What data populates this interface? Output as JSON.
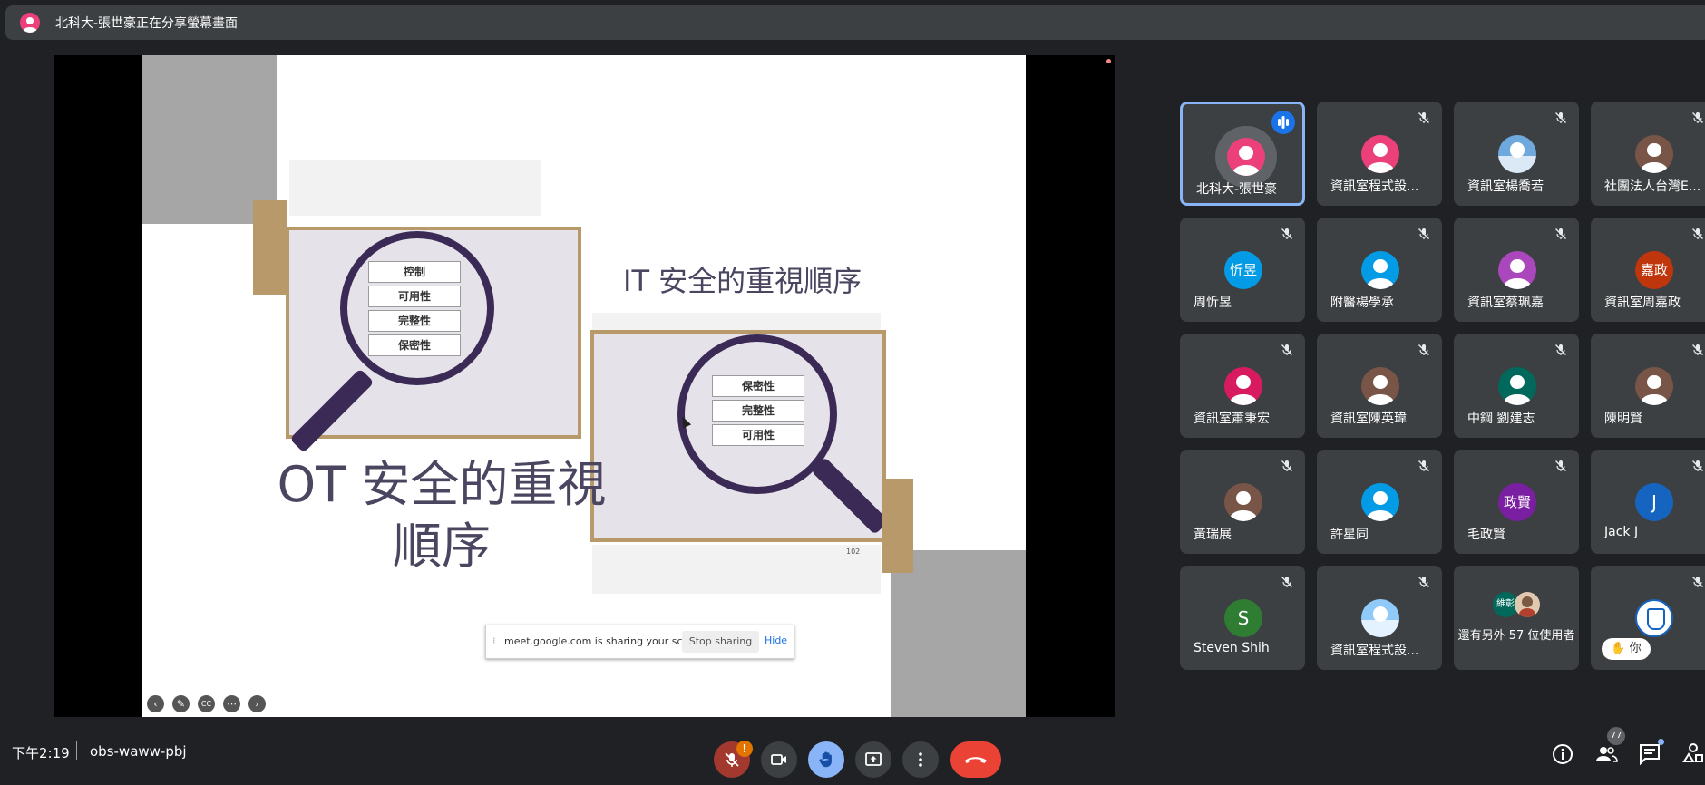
{
  "header": {
    "presenter_text": "北科大-張世豪正在分享螢幕畫面"
  },
  "slide": {
    "it_title": "IT 安全的重視順序",
    "ot_title": "OT 安全的重視順序",
    "ot_labels": [
      "控制",
      "可用性",
      "完整性",
      "保密性"
    ],
    "it_labels": [
      "保密性",
      "完整性",
      "可用性"
    ],
    "page_number": "102",
    "controls": [
      "prev",
      "pen",
      "cc",
      "more",
      "next"
    ]
  },
  "share_bar": {
    "message": "meet.google.com is sharing your screen.",
    "stop_label": "Stop sharing",
    "hide_label": "Hide"
  },
  "participants": [
    {
      "name": "北科大-張世豪",
      "avatar": "person",
      "color": "#ec407a",
      "speaking": true
    },
    {
      "name": "資訊室程式設...",
      "avatar": "person",
      "color": "#ec407a"
    },
    {
      "name": "資訊室楊喬若",
      "avatar": "photo",
      "color": "#6fa8dc"
    },
    {
      "name": "社團法人台灣E...",
      "avatar": "person",
      "color": "#795548"
    },
    {
      "name": "周忻昱",
      "avatar": "忻昱",
      "color": "#039be5"
    },
    {
      "name": "附醫楊學承",
      "avatar": "person",
      "color": "#039be5"
    },
    {
      "name": "資訊室蔡珮嘉",
      "avatar": "person",
      "color": "#ab47bc"
    },
    {
      "name": "資訊室周嘉政",
      "avatar": "嘉政",
      "color": "#bf360c"
    },
    {
      "name": "資訊室蕭秉宏",
      "avatar": "person",
      "color": "#d81b60"
    },
    {
      "name": "資訊室陳英瑋",
      "avatar": "person",
      "color": "#795548"
    },
    {
      "name": "中鋼 劉建志",
      "avatar": "person",
      "color": "#00695c"
    },
    {
      "name": "陳明賢",
      "avatar": "person",
      "color": "#795548"
    },
    {
      "name": "黃瑞展",
      "avatar": "person",
      "color": "#795548"
    },
    {
      "name": "許星同",
      "avatar": "person",
      "color": "#039be5"
    },
    {
      "name": "毛政賢",
      "avatar": "政賢",
      "color": "#7b1fa2"
    },
    {
      "name": "Jack J",
      "avatar": "J",
      "color": "#1565c0"
    },
    {
      "name": "Steven Shih",
      "avatar": "S",
      "color": "#2e7d32"
    },
    {
      "name": "資訊室程式設...",
      "avatar": "photo",
      "color": "#90caf9"
    }
  ],
  "others_tile": {
    "label": "還有另外 57 位使用者",
    "badge_text": "維彰"
  },
  "self_tile": {
    "chip_label": "你"
  },
  "bottom_bar": {
    "time": "下午2:19",
    "meeting_code": "obs-waww-pbj",
    "mic_warning": "!",
    "participant_count": "77"
  },
  "colors": {
    "background": "#202124",
    "tile": "#3c4043",
    "end_call": "#ea4335",
    "accent": "#8ab4f8"
  }
}
